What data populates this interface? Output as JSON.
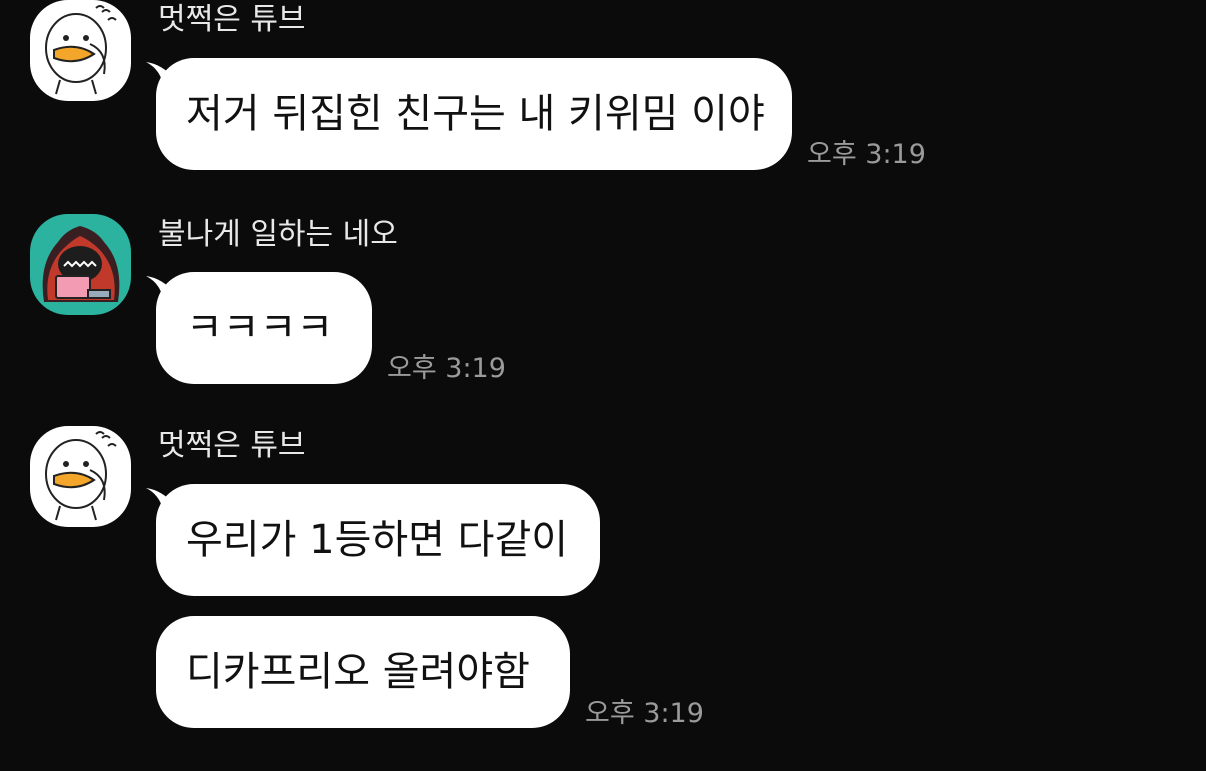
{
  "messages": [
    {
      "sender": "멋쩍은 튜브",
      "avatar_icon": "tube-duck-avatar-icon",
      "bubbles": [
        "저거 뒤집힌 친구는 내 키위밈 이야"
      ],
      "time": "오후 3:19"
    },
    {
      "sender": "불나게 일하는 네오",
      "avatar_icon": "neo-working-laptop-avatar-icon",
      "bubbles": [
        "ㅋㅋㅋㅋ"
      ],
      "time": "오후 3:19"
    },
    {
      "sender": "멋쩍은 튜브",
      "avatar_icon": "tube-duck-avatar-icon",
      "bubbles": [
        "우리가 1등하면 다같이",
        "디카프리오 올려야함"
      ],
      "time": "오후 3:19"
    }
  ],
  "colors": {
    "background": "#0b0b0b",
    "bubble": "#ffffff",
    "timestamp": "#9b9b9b",
    "tube_beak": "#f4a62a",
    "neo_background": "#2bb3a0"
  }
}
